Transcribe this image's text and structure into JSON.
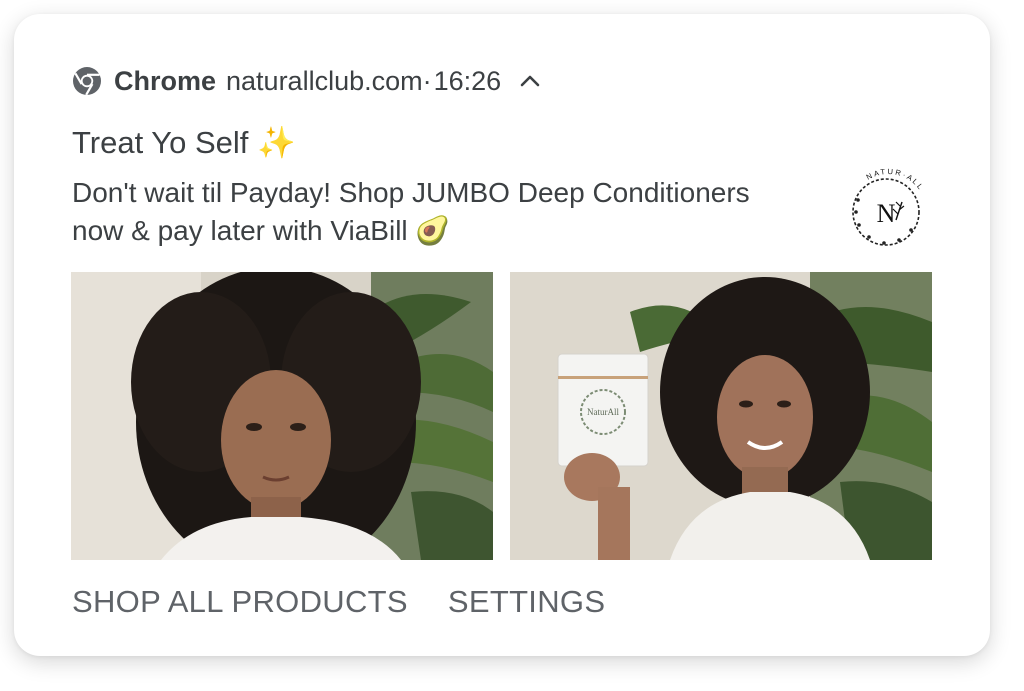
{
  "notification": {
    "app_name": "Chrome",
    "domain": "naturallclub.com·",
    "time": "16:26",
    "title": "Treat Yo Self ✨",
    "body": "Don't wait til Payday! Shop JUMBO Deep Conditioners now & pay later with ViaBill 🥑",
    "logo": {
      "letter": "N",
      "ring_text": "NATUR·ALL"
    },
    "images": [
      {
        "icon": "photo-woman-portrait"
      },
      {
        "icon": "photo-woman-holding-product",
        "product_label": "NaturAll"
      }
    ],
    "actions": [
      {
        "label": "SHOP ALL PRODUCTS"
      },
      {
        "label": "SETTINGS"
      }
    ]
  },
  "colors": {
    "text": "#3c4043",
    "action_text": "#5f6368",
    "background": "#ffffff"
  }
}
